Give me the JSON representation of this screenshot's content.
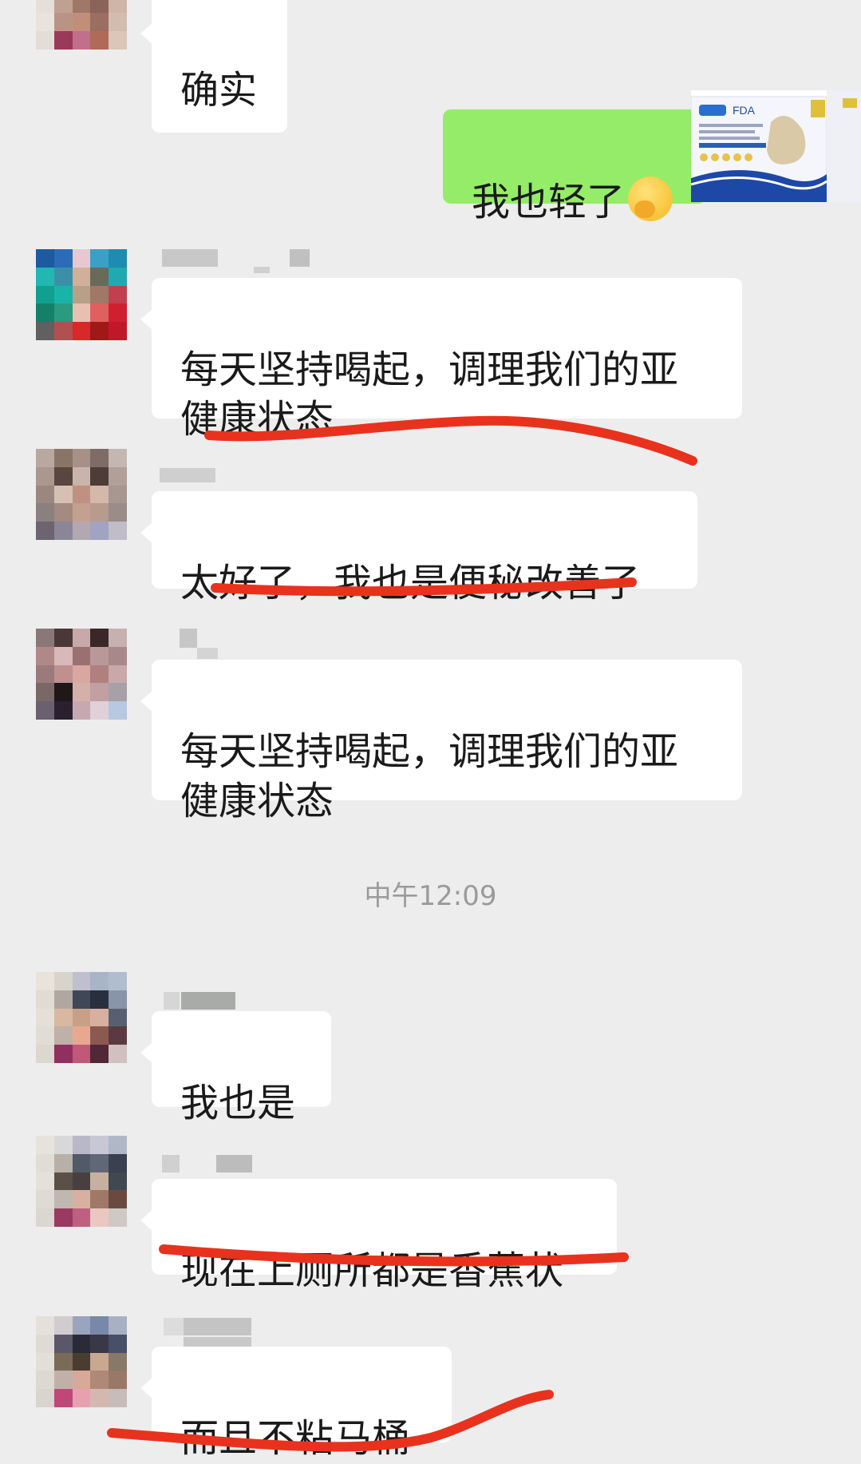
{
  "chat": {
    "messages": [
      {
        "id": "m1",
        "side": "left",
        "text": "确实"
      },
      {
        "id": "m2",
        "side": "right",
        "text": "我也轻了",
        "emoji": "hand-over-mouth-emoji"
      },
      {
        "id": "m3",
        "side": "left",
        "text": "每天坚持喝起，调理我们的亚\n健康状态"
      },
      {
        "id": "m4",
        "side": "left",
        "text": "太好了，我也是便秘改善了"
      },
      {
        "id": "m5",
        "side": "left",
        "text": "每天坚持喝起，调理我们的亚\n健康状态"
      },
      {
        "id": "m6",
        "side": "left",
        "text": "我也是"
      },
      {
        "id": "m7",
        "side": "left",
        "text": "现在上厕所都是香蕉状"
      },
      {
        "id": "m8",
        "side": "left",
        "text": "而且不粘马桶"
      }
    ],
    "timestamp": "中午12:09"
  },
  "product_image": {
    "brand_mark": "FDA"
  },
  "colors": {
    "background": "#ededed",
    "bubble_left": "#ffffff",
    "bubble_right": "#95ec69",
    "annotation": "#e8321e",
    "timestamp": "#9a9a9a"
  }
}
